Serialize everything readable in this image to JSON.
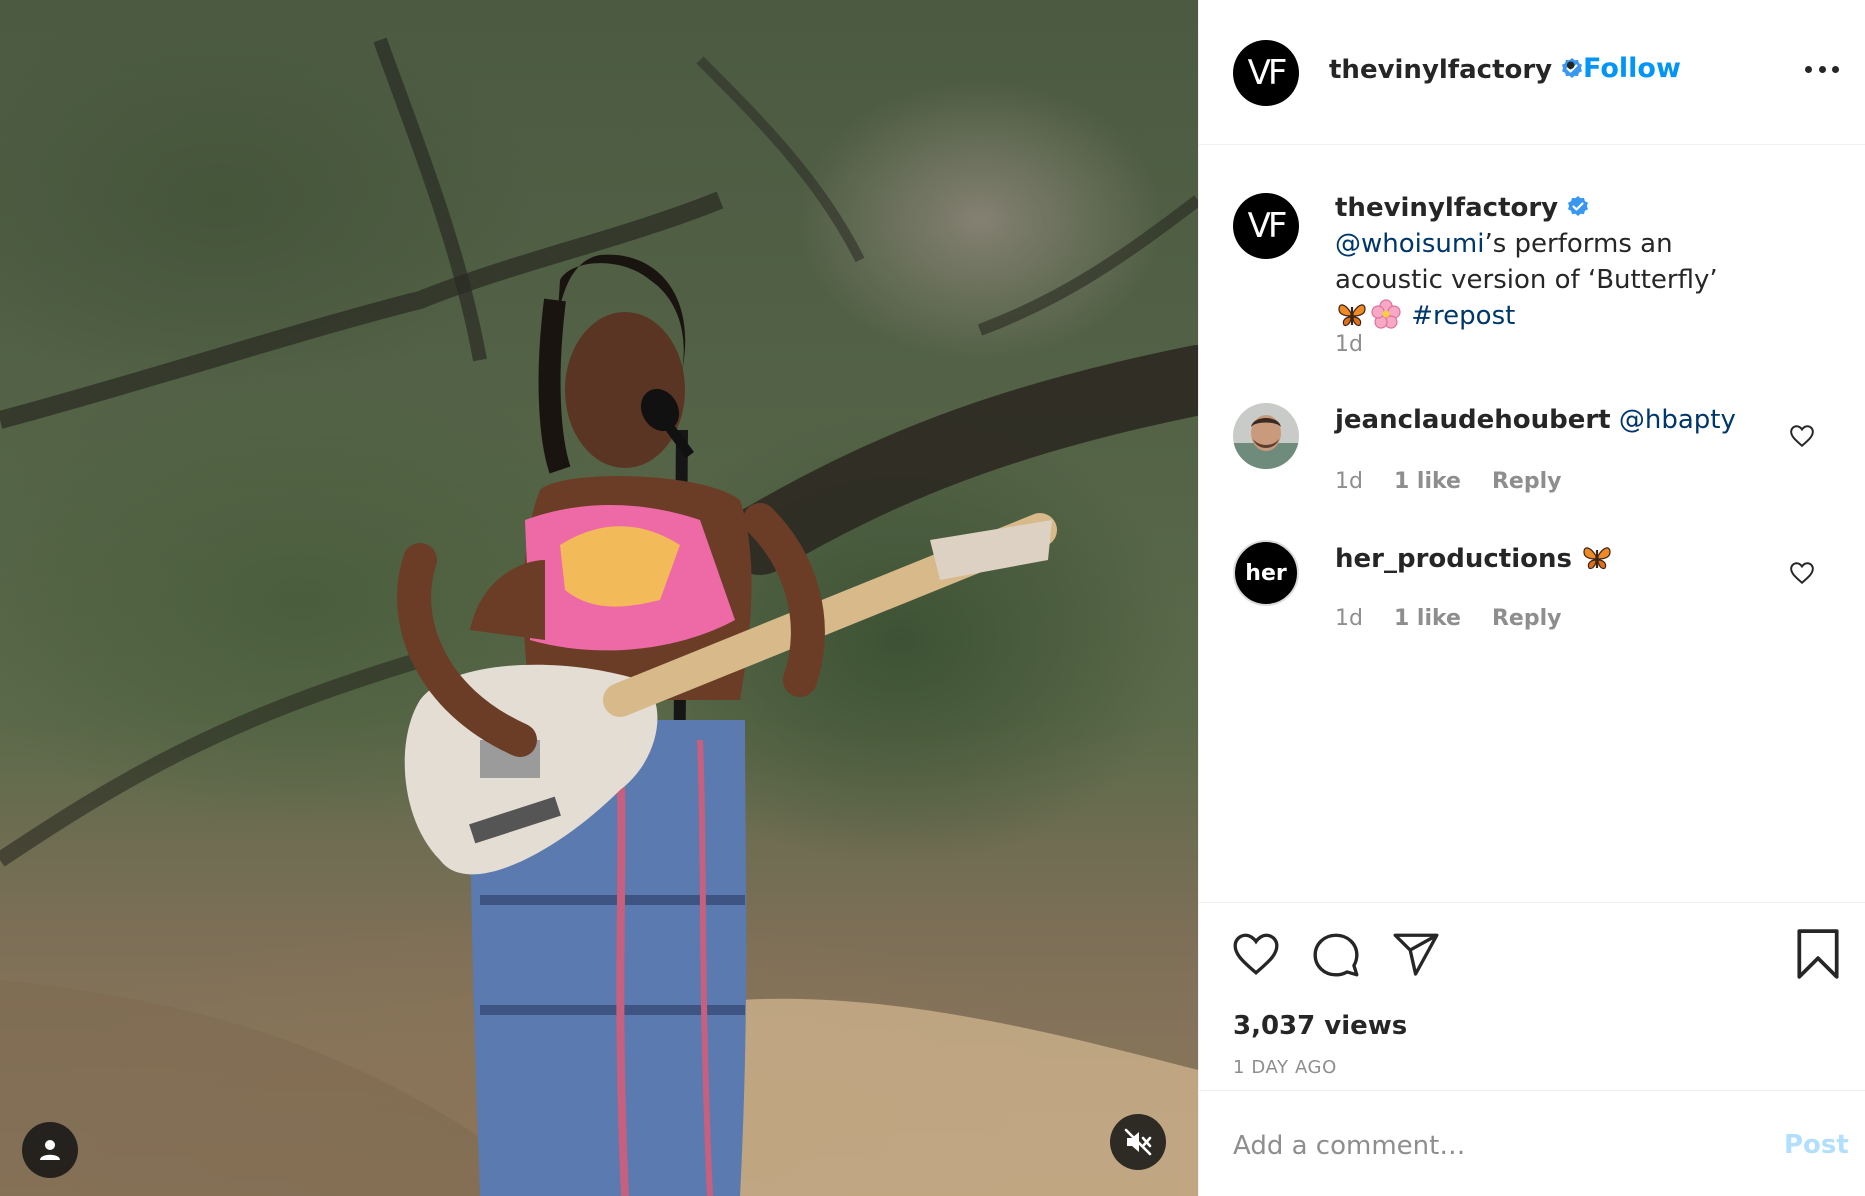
{
  "post": {
    "username": "thevinylfactory",
    "avatar_initials": "VF",
    "follow_label": "Follow",
    "separator": "•",
    "more_icon": "ellipsis-icon"
  },
  "caption": {
    "username": "thevinylfactory",
    "mention": "@whoisumi",
    "text_after_mention": "’s performs an acoustic version of ‘Butterfly’",
    "emojis": [
      "butterfly",
      "cherry-blossom"
    ],
    "hashtag": "#repost",
    "time": "1d"
  },
  "comments": [
    {
      "username": "jeanclaudehoubert",
      "text": "@hbapty",
      "time": "1d",
      "likes": "1 like",
      "reply": "Reply"
    },
    {
      "username": "her_productions",
      "avatar_text": "her",
      "emoji": "butterfly",
      "time": "1d",
      "likes": "1 like",
      "reply": "Reply"
    }
  ],
  "stats": {
    "views": "3,037 views",
    "posted": "1 DAY AGO"
  },
  "add_comment": {
    "placeholder": "Add a comment…",
    "post_label": "Post"
  },
  "colors": {
    "accent": "#0095f6",
    "mention": "#00376b",
    "muted": "#8e8e8e",
    "post_disabled": "#b2dffc"
  }
}
